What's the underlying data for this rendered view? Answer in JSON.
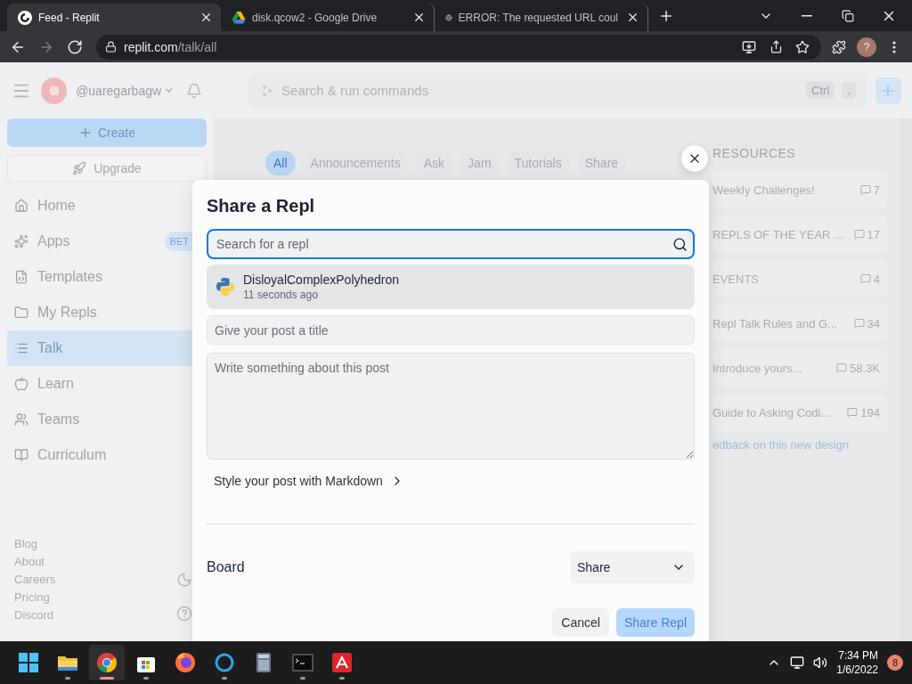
{
  "browser": {
    "tabs": [
      {
        "title": "Feed - Replit",
        "kind": "replit",
        "selected": true
      },
      {
        "title": "disk.qcow2 - Google Drive",
        "kind": "drive",
        "selected": false
      },
      {
        "title": "ERROR: The requested URL coul",
        "kind": "globe",
        "selected": false
      }
    ],
    "nav_buttons": [
      {
        "kind": "back",
        "disabled": false
      },
      {
        "kind": "forward",
        "disabled": true
      },
      {
        "kind": "reload",
        "disabled": false
      }
    ],
    "address": {
      "host": "replit.com",
      "path": "/talk/all"
    },
    "profile": "?"
  },
  "header": {
    "username": "@uaregarbagw",
    "search_placeholder": "Search & run commands",
    "keys": [
      "Ctrl",
      "."
    ]
  },
  "sidebar": {
    "create": "Create",
    "upgrade": "Upgrade",
    "nav": [
      {
        "label": "Home",
        "kind": "home",
        "selected": false
      },
      {
        "label": "Apps",
        "kind": "apps",
        "selected": false,
        "badge": "BET"
      },
      {
        "label": "Templates",
        "kind": "templates",
        "selected": false
      },
      {
        "label": "My Repls",
        "kind": "repls",
        "selected": false
      },
      {
        "label": "Talk",
        "kind": "talk",
        "selected": true
      },
      {
        "label": "Learn",
        "kind": "learn",
        "selected": false
      },
      {
        "label": "Teams",
        "kind": "teams",
        "selected": false
      },
      {
        "label": "Curriculum",
        "kind": "curriculum",
        "selected": false
      }
    ],
    "footer": [
      "Blog",
      "About",
      "Careers",
      "Pricing",
      "Discord"
    ]
  },
  "feed": {
    "filters": [
      {
        "label": "All",
        "selected": true
      },
      {
        "label": "Announcements",
        "selected": false
      },
      {
        "label": "Ask",
        "selected": false
      },
      {
        "label": "Jam",
        "selected": false
      },
      {
        "label": "Tutorials",
        "selected": false
      },
      {
        "label": "Share",
        "selected": false
      }
    ]
  },
  "resources": {
    "heading": "RESOURCES",
    "items": [
      {
        "title": "Weekly Challenges!",
        "count": "7"
      },
      {
        "title": "REPLS OF THE YEAR ...",
        "count": "17"
      },
      {
        "title": "EVENTS",
        "count": "4"
      },
      {
        "title": "Repl Talk Rules and G...",
        "count": "34"
      },
      {
        "title": "Introduce yours...",
        "count": "58.3K"
      },
      {
        "title": "Guide to Asking Codi...",
        "count": "194"
      }
    ],
    "feedback": "edback on this new design"
  },
  "modal": {
    "title": "Share a Repl",
    "search_placeholder": "Search for a repl",
    "results": [
      {
        "name": "DisloyalComplexPolyhedron",
        "time": "11 seconds ago",
        "hovered": true
      }
    ],
    "title_placeholder": "Give your post a title",
    "body_placeholder": "Write something about this post",
    "markdown_link": "Style your post with Markdown",
    "board_label": "Board",
    "board_value": "Share",
    "cancel": "Cancel",
    "submit": {
      "label": "Share Repl",
      "disabled": true
    }
  },
  "taskbar": {
    "apps": [
      {
        "kind": "start",
        "running": false,
        "active": false
      },
      {
        "kind": "explorer",
        "running": true,
        "active": false
      },
      {
        "kind": "chrome",
        "running": true,
        "active": true
      },
      {
        "kind": "store",
        "running": true,
        "active": false
      },
      {
        "kind": "firefox",
        "running": false,
        "active": false
      },
      {
        "kind": "cortana",
        "running": true,
        "active": false
      },
      {
        "kind": "calculator",
        "running": false,
        "active": false
      },
      {
        "kind": "terminal",
        "running": true,
        "active": false
      },
      {
        "kind": "avira",
        "running": true,
        "active": false
      }
    ],
    "time": "7:34 PM",
    "date": "1/6/2022",
    "notifications": "8"
  }
}
